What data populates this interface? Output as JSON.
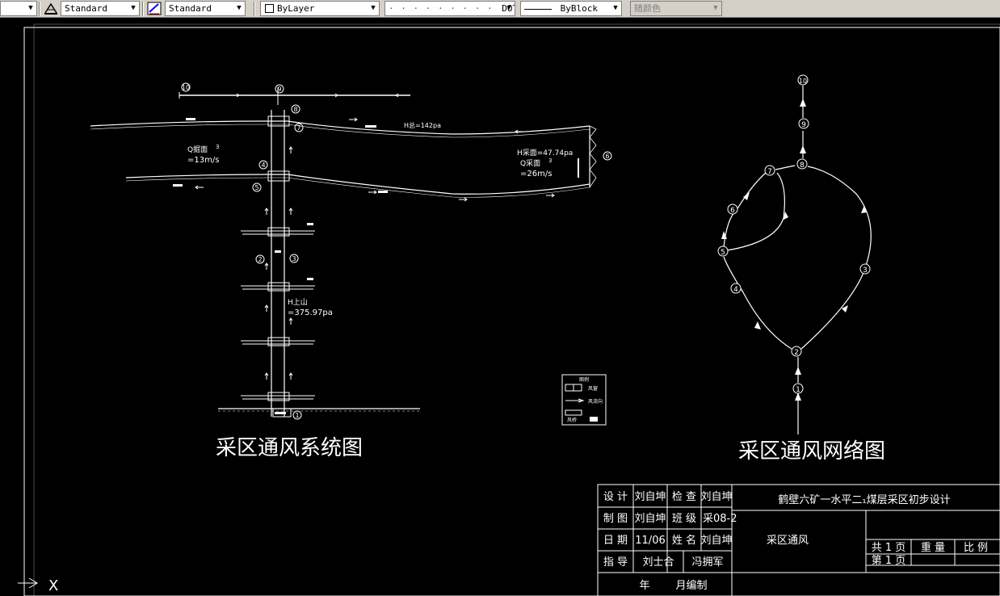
{
  "toolbar": {
    "text_style": "Standard",
    "dim_style": "Standard",
    "layer": "ByLayer",
    "linetype": "DOT",
    "lineweight": "ByBlock",
    "color": "随颜色"
  },
  "drawing": {
    "left_title": "采区通风系统图",
    "right_title": "采区通风网络图",
    "system_labels": {
      "h_main": "H总=142pa",
      "h_upper": "H上山",
      "h_upper_val": "=375.97pa",
      "h_work": "H采面=47.74pa",
      "q_work_label": "Q采面",
      "q_work_val": "=26m/s",
      "q_tunnel_label": "Q掘面",
      "q_tunnel_val": "=13m/s",
      "cube": "3"
    },
    "node_numbers": [
      "①",
      "②",
      "③",
      "④",
      "⑤",
      "⑥",
      "⑦",
      "⑧",
      "⑨",
      "⑩"
    ],
    "legend": {
      "title": "图例",
      "item1": "风窗",
      "item2": "风流向",
      "item3": "风桥"
    }
  },
  "title_block": {
    "design_label": "设 计",
    "design_name": "刘自坤",
    "check_label": "检 查",
    "check_name": "刘自坤",
    "project": "鹤壁六矿一水平二₁煤层采区初步设计",
    "draw_label": "制 图",
    "draw_name": "刘自坤",
    "class_label": "班 级",
    "class_val": "采08-2",
    "date_label": "日 期",
    "date_val": "11/06",
    "name_label": "姓 名",
    "name_val": "刘自坤",
    "drawing_name": "采区通风",
    "guide_label": "指 导",
    "guide_name1": "刘士合",
    "guide_name2": "冯拥军",
    "year_label": "年",
    "month_label": "月编制",
    "total_pages": "共 1 页",
    "weight": "重 量",
    "scale": "比 例",
    "page_no": "第 1 页"
  },
  "ucs": {
    "x_label": "X"
  }
}
